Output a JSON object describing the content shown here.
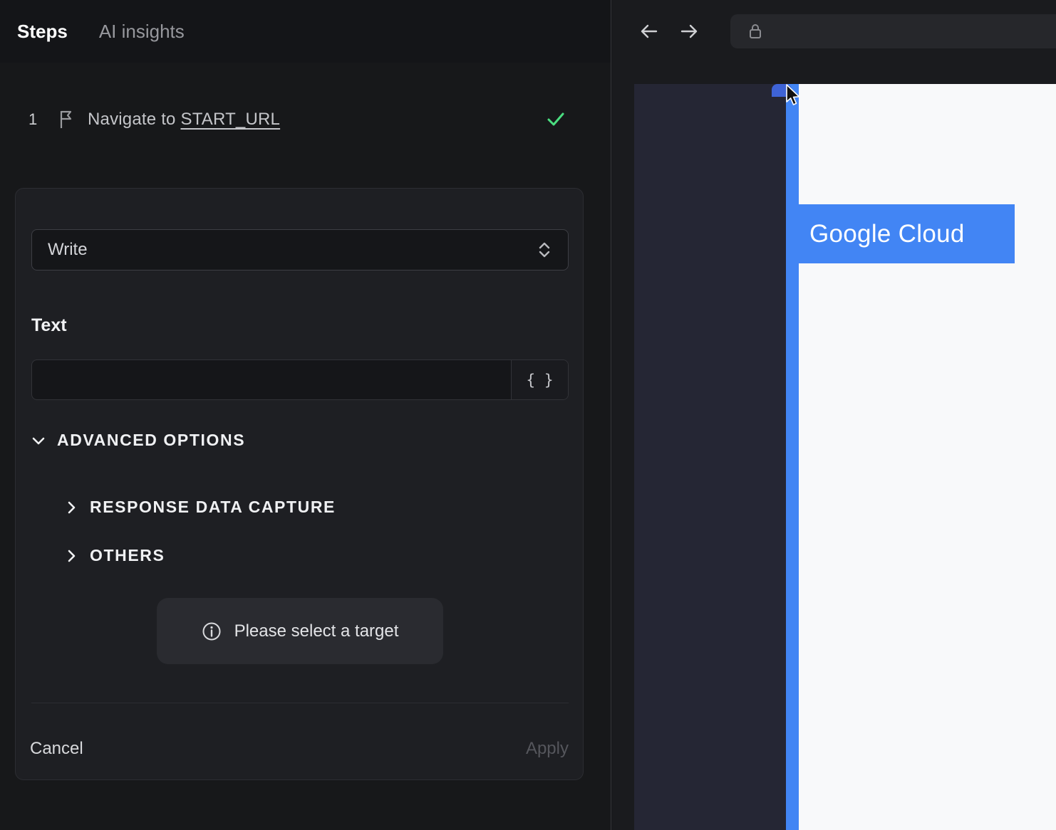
{
  "left_panel": {
    "tabs": [
      {
        "label": "Steps"
      },
      {
        "label": "AI insights"
      }
    ],
    "step": {
      "number": "1",
      "action": "Navigate to ",
      "target": "START_URL",
      "status": "success"
    },
    "editor": {
      "action_value": "Write",
      "text_label": "Text",
      "text_input_value": "",
      "variable_button_label": "{ }",
      "advanced_label": "ADVANCED OPTIONS",
      "response_capture_label": "RESPONSE DATA CAPTURE",
      "others_label": "OTHERS",
      "notice": "Please select a target",
      "cancel_label": "Cancel",
      "apply_label": "Apply"
    }
  },
  "browser": {
    "highlight_label": "Google Cloud"
  },
  "colors": {
    "accent_blue": "#4285f4",
    "success_green": "#4ade80",
    "panel_bg": "#17181a",
    "page_dark": "#252634",
    "page_light": "#f8f9fa"
  },
  "icons": {
    "step": "flag-icon",
    "step_status": "check-icon",
    "select": "unfold-chevrons-icon",
    "advanced": "chevron-down-icon",
    "sections": "chevron-right-icon",
    "notice": "info-icon",
    "nav": [
      "back-arrow-icon",
      "forward-arrow-icon"
    ],
    "url": "lock-icon",
    "pointer": "cursor-arrow-icon"
  }
}
